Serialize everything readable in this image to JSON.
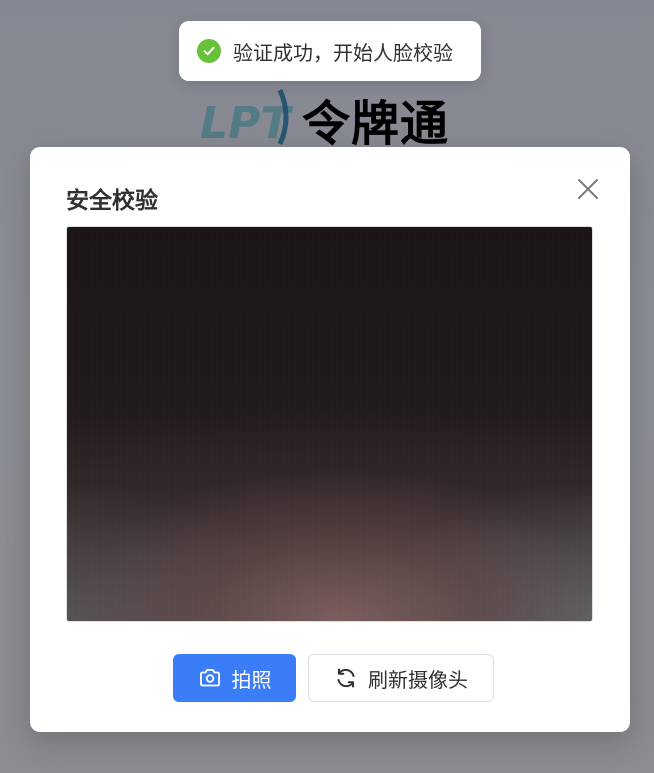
{
  "background": {
    "logo_mark_text": "LPT",
    "logo_text": "令牌通"
  },
  "toast": {
    "icon": "check-circle-icon",
    "message": "验证成功，开始人脸校验",
    "color": "#67c23a"
  },
  "dialog": {
    "title": "安全校验",
    "close_icon": "close-icon",
    "camera_view": "camera-preview",
    "buttons": {
      "capture": {
        "label": "拍照",
        "icon": "camera-icon",
        "color": "#3b7cf7"
      },
      "refresh": {
        "label": "刷新摄像头",
        "icon": "refresh-icon"
      }
    }
  }
}
